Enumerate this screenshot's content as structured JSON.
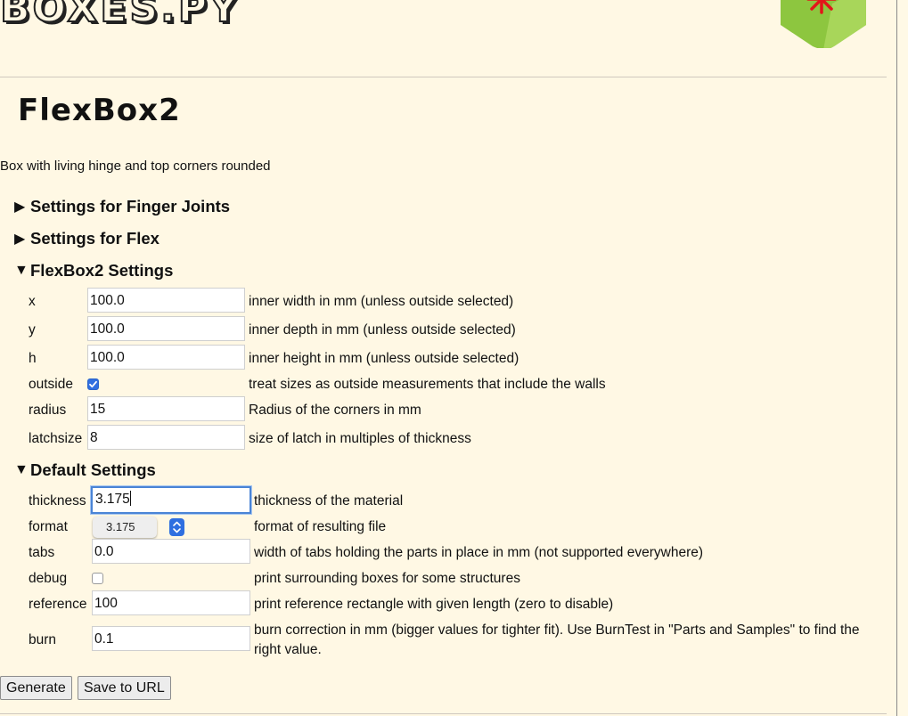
{
  "header": {
    "logo_text": "BOXES.PY"
  },
  "page": {
    "title": "FlexBox2",
    "description": "Box with living hinge and top corners rounded"
  },
  "sections": {
    "finger_joints": "Settings for Finger Joints",
    "flex": "Settings for Flex",
    "flexbox2": "FlexBox2 Settings",
    "defaults": "Default Settings",
    "collapsed_marker": "▶",
    "expanded_marker": "▼"
  },
  "flexbox2_settings": {
    "x": {
      "label": "x",
      "value": "100.0",
      "desc": "inner width in mm (unless outside selected)"
    },
    "y": {
      "label": "y",
      "value": "100.0",
      "desc": "inner depth in mm (unless outside selected)"
    },
    "h": {
      "label": "h",
      "value": "100.0",
      "desc": "inner height in mm (unless outside selected)"
    },
    "outside": {
      "label": "outside",
      "checked": true,
      "desc": "treat sizes as outside measurements that include the walls"
    },
    "radius": {
      "label": "radius",
      "value": "15",
      "desc": "Radius of the corners in mm"
    },
    "latchsize": {
      "label": "latchsize",
      "value": "8",
      "desc": "size of latch in multiples of thickness"
    }
  },
  "default_settings": {
    "thickness": {
      "label": "thickness",
      "value": "3.175",
      "desc": "thickness of the material"
    },
    "format": {
      "label": "format",
      "selected": "3.175",
      "desc": "format of resulting file"
    },
    "tabs": {
      "label": "tabs",
      "value": "0.0",
      "desc": "width of tabs holding the parts in place in mm (not supported everywhere)"
    },
    "debug": {
      "label": "debug",
      "checked": false,
      "desc": "print surrounding boxes for some structures"
    },
    "reference": {
      "label": "reference",
      "value": "100",
      "desc": "print reference rectangle with given length (zero to disable)"
    },
    "burn": {
      "label": "burn",
      "value": "0.1",
      "desc_line1": "burn correction in mm (bigger values for tighter fit). Use BurnTest in \"Parts and Samples\" to find the",
      "desc_line2": "right value."
    }
  },
  "actions": {
    "generate": "Generate",
    "save_url": "Save to URL"
  },
  "colors": {
    "background": "#fff8e4",
    "accent_blue": "#2f6fe0",
    "badge_green": "#8dc63f",
    "badge_red": "#e3151a"
  }
}
